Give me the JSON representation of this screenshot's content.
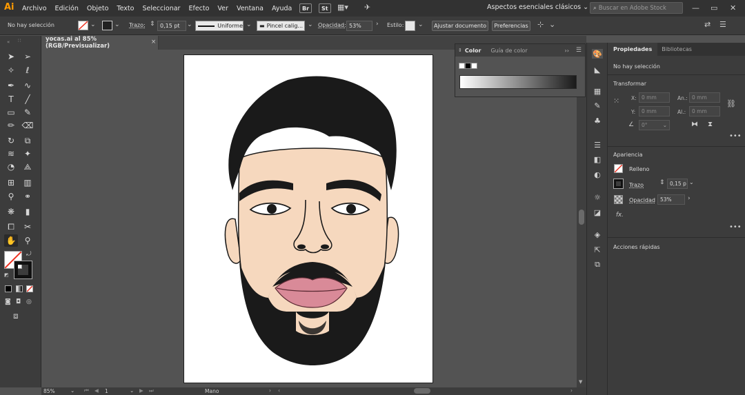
{
  "app": {
    "logo": "Ai"
  },
  "menu": [
    "Archivo",
    "Edición",
    "Objeto",
    "Texto",
    "Seleccionar",
    "Efecto",
    "Ver",
    "Ventana",
    "Ayuda"
  ],
  "menu_buttons": {
    "bridge": "Br",
    "stock": "St"
  },
  "workspace": "Aspectos esenciales clásicos",
  "search": {
    "placeholder": "Buscar en Adobe Stock"
  },
  "control": {
    "selection": "No hay selección",
    "stroke_label": "Trazo:",
    "stroke_weight": "0,15 pt",
    "profile": "Uniforme",
    "brush": "Pincel calig...",
    "opacity_label": "Opacidad:",
    "opacity_value": "53%",
    "style_label": "Estilo:",
    "doc_setup": "Ajustar documento",
    "preferences": "Preferencias"
  },
  "document": {
    "tab": "yocas.ai al 85% (RGB/Previsualizar)"
  },
  "status": {
    "zoom": "85%",
    "artboard_num": "1",
    "tool": "Mano"
  },
  "color_panel": {
    "tab_color": "Color",
    "tab_guide": "Guía de color"
  },
  "properties": {
    "tab_props": "Propiedades",
    "tab_libraries": "Bibliotecas",
    "no_selection": "No hay selección",
    "transform_title": "Transformar",
    "x_label": "X:",
    "y_label": "Y:",
    "w_label": "An.:",
    "h_label": "Al.:",
    "x_value": "0 mm",
    "y_value": "0 mm",
    "w_value": "0 mm",
    "h_value": "0 mm",
    "angle_value": "0°",
    "appearance_title": "Apariencia",
    "fill_label": "Relleno",
    "stroke_label": "Trazo",
    "stroke_value": "0,15 p",
    "opacity_label": "Opacidad",
    "opacity_value": "53%",
    "fx_label": "fx.",
    "quick_actions_title": "Acciones rápidas"
  },
  "colors": {
    "accent": "#ff9a00",
    "skin": "#f6d8be",
    "hair": "#1a1a1a",
    "lips": "#d98a98"
  }
}
